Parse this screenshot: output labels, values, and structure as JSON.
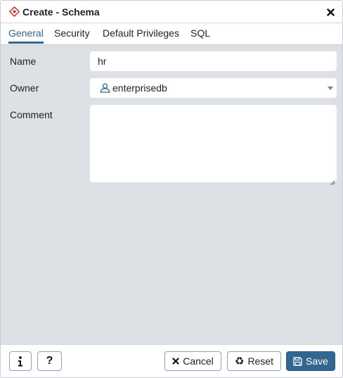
{
  "dialog": {
    "title": "Create - Schema",
    "title_icon": "schema-diamond-icon",
    "close_icon": "close-icon"
  },
  "tabs": [
    {
      "label": "General",
      "active": true
    },
    {
      "label": "Security",
      "active": false
    },
    {
      "label": "Default Privileges",
      "active": false
    },
    {
      "label": "SQL",
      "active": false
    }
  ],
  "form": {
    "name_label": "Name",
    "name_value": "hr",
    "owner_label": "Owner",
    "owner_value": "enterprisedb",
    "owner_icon": "user-role-icon",
    "comment_label": "Comment",
    "comment_value": ""
  },
  "footer": {
    "info_icon": "info-icon",
    "help_icon": "question-icon",
    "cancel_label": "Cancel",
    "reset_label": "Reset",
    "save_label": "Save"
  },
  "colors": {
    "accent": "#326690",
    "body_bg": "#dde0e5",
    "title_icon_red": "#c4332c"
  }
}
